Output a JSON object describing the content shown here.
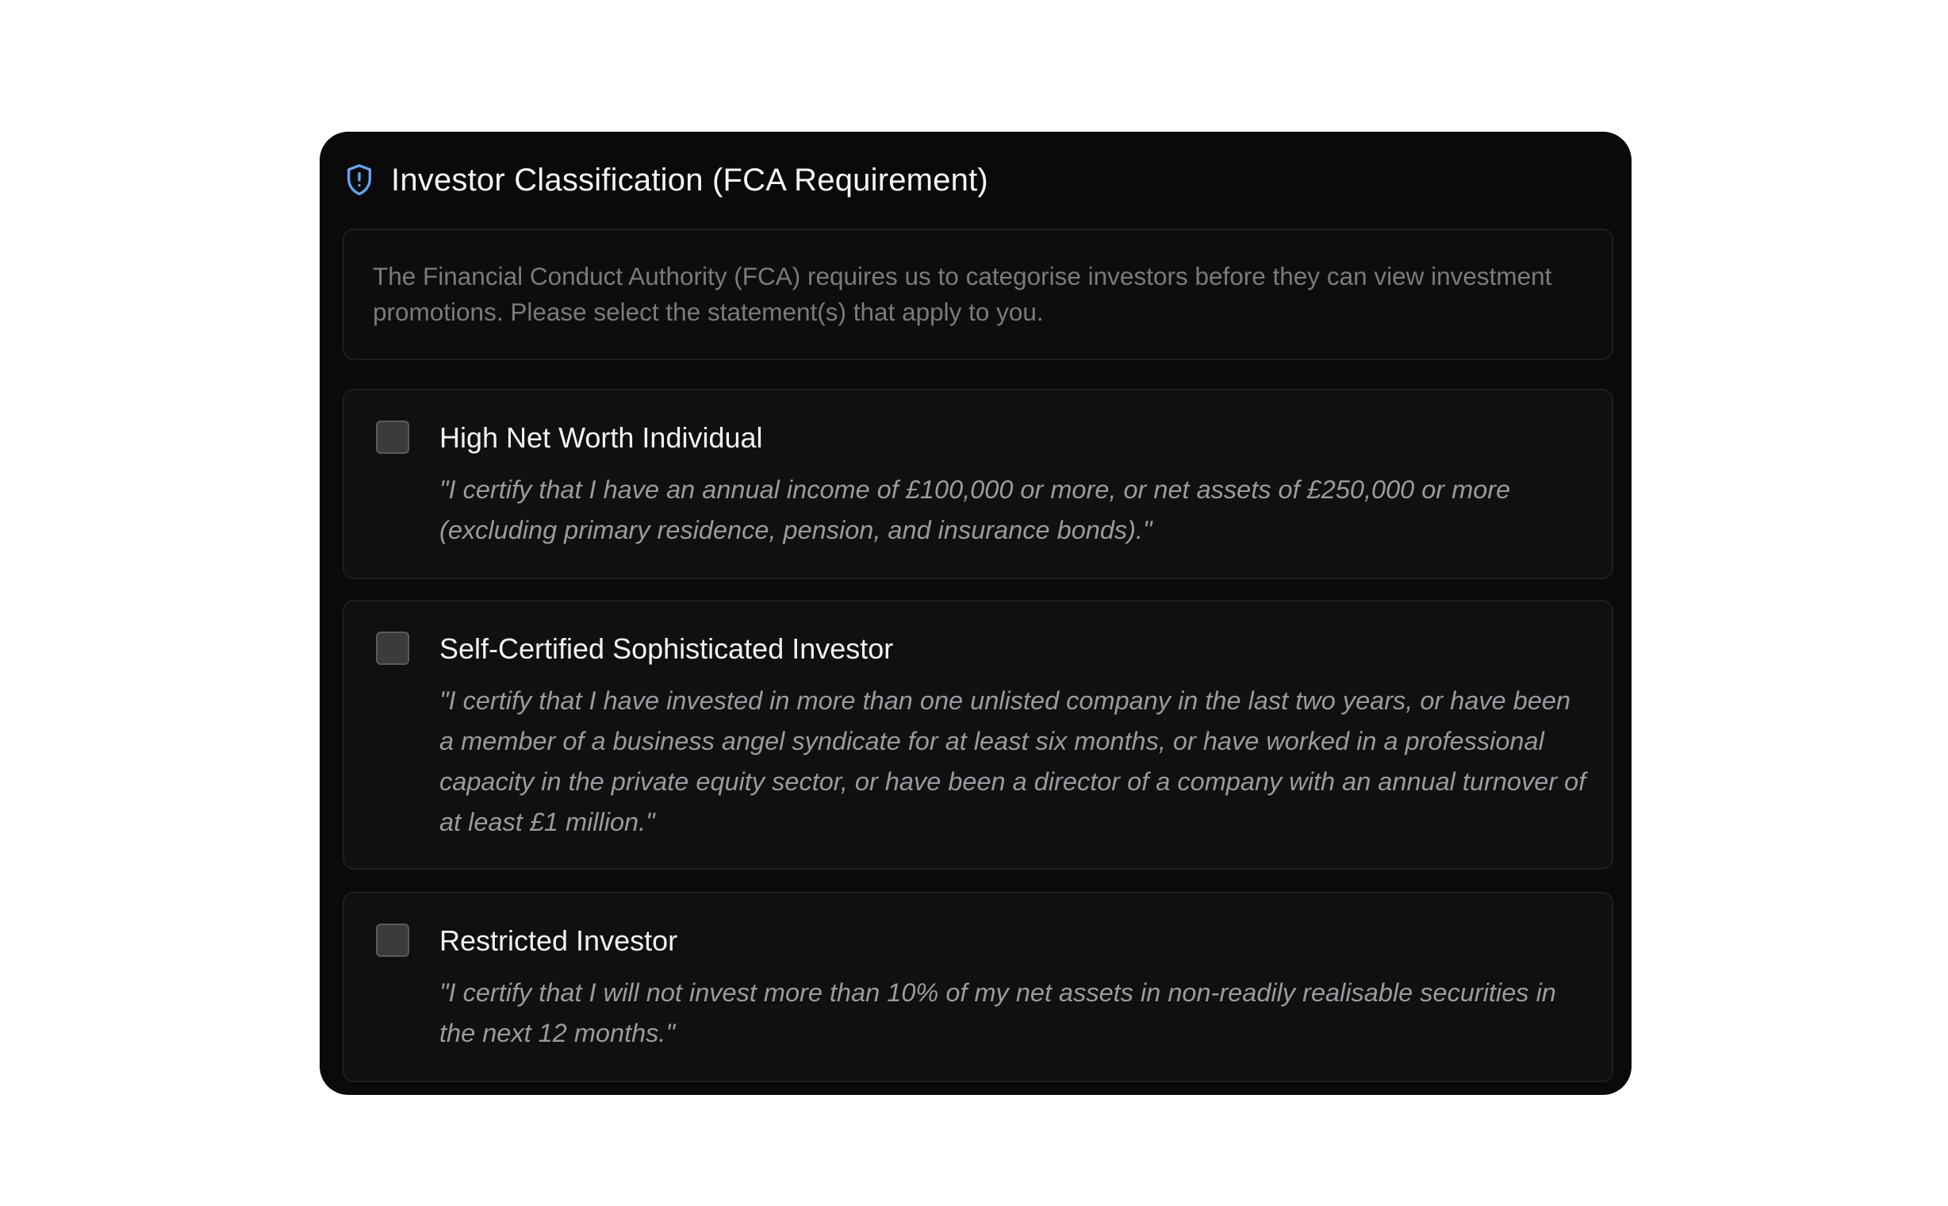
{
  "card": {
    "title": "Investor Classification (FCA Requirement)",
    "icon": "shield-alert-icon",
    "accent_color": "#60a5fa"
  },
  "intro": {
    "text": "The Financial Conduct Authority (FCA) requires us to categorise investors before they can view investment promotions. Please select the statement(s) that apply to you."
  },
  "options": [
    {
      "title": "High Net Worth Individual",
      "checked": false,
      "description": "\"I certify that I have an annual income of £100,000 or more, or net assets of £250,000 or more (excluding primary residence, pension, and insurance bonds).\""
    },
    {
      "title": "Self-Certified Sophisticated Investor",
      "checked": false,
      "description": "\"I certify that I have invested in more than one unlisted company in the last two years, or have been a member of a business angel syndicate for at least six months, or have worked in a professional capacity in the private equity sector, or have been a director of a company with an annual turnover of at least £1 million.\""
    },
    {
      "title": "Restricted Investor",
      "checked": false,
      "description": "\"I certify that I will not invest more than 10% of my net assets in non-readily realisable securities in the next 12 months.\""
    }
  ]
}
